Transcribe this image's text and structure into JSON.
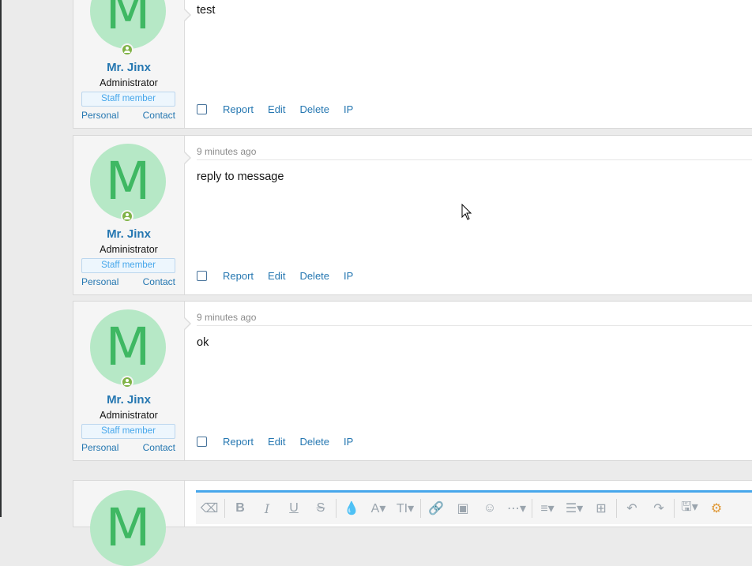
{
  "posts": [
    {
      "time": "",
      "message": "test",
      "user": {
        "initial": "M",
        "name": "Mr. Jinx",
        "title": "Administrator",
        "badge": "Staff member",
        "link_personal": "Personal",
        "link_contact": "Contact"
      },
      "actions": [
        "Report",
        "Edit",
        "Delete",
        "IP"
      ]
    },
    {
      "time": "9 minutes ago",
      "message": "reply to message",
      "user": {
        "initial": "M",
        "name": "Mr. Jinx",
        "title": "Administrator",
        "badge": "Staff member",
        "link_personal": "Personal",
        "link_contact": "Contact"
      },
      "actions": [
        "Report",
        "Edit",
        "Delete",
        "IP"
      ]
    },
    {
      "time": "9 minutes ago",
      "message": "ok",
      "user": {
        "initial": "M",
        "name": "Mr. Jinx",
        "title": "Administrator",
        "badge": "Staff member",
        "link_personal": "Personal",
        "link_contact": "Contact"
      },
      "actions": [
        "Report",
        "Edit",
        "Delete",
        "IP"
      ]
    }
  ],
  "editor": {
    "avatar_initial": "M",
    "toolbar_icons": [
      "eraser-icon",
      "bold-icon",
      "italic-icon",
      "underline-icon",
      "strikethrough-icon",
      "color-icon",
      "font-icon",
      "font-size-icon",
      "link-icon",
      "image-icon",
      "smilie-icon",
      "more-icon",
      "align-icon",
      "list-icon",
      "table-icon",
      "undo-icon",
      "redo-icon",
      "drafts-icon",
      "settings-icon"
    ]
  },
  "colors": {
    "link": "#2577b1",
    "avatar_bg": "#b6e8c6",
    "avatar_fg": "#3fb863",
    "online": "#7fb245",
    "accent": "#47a7eb"
  }
}
